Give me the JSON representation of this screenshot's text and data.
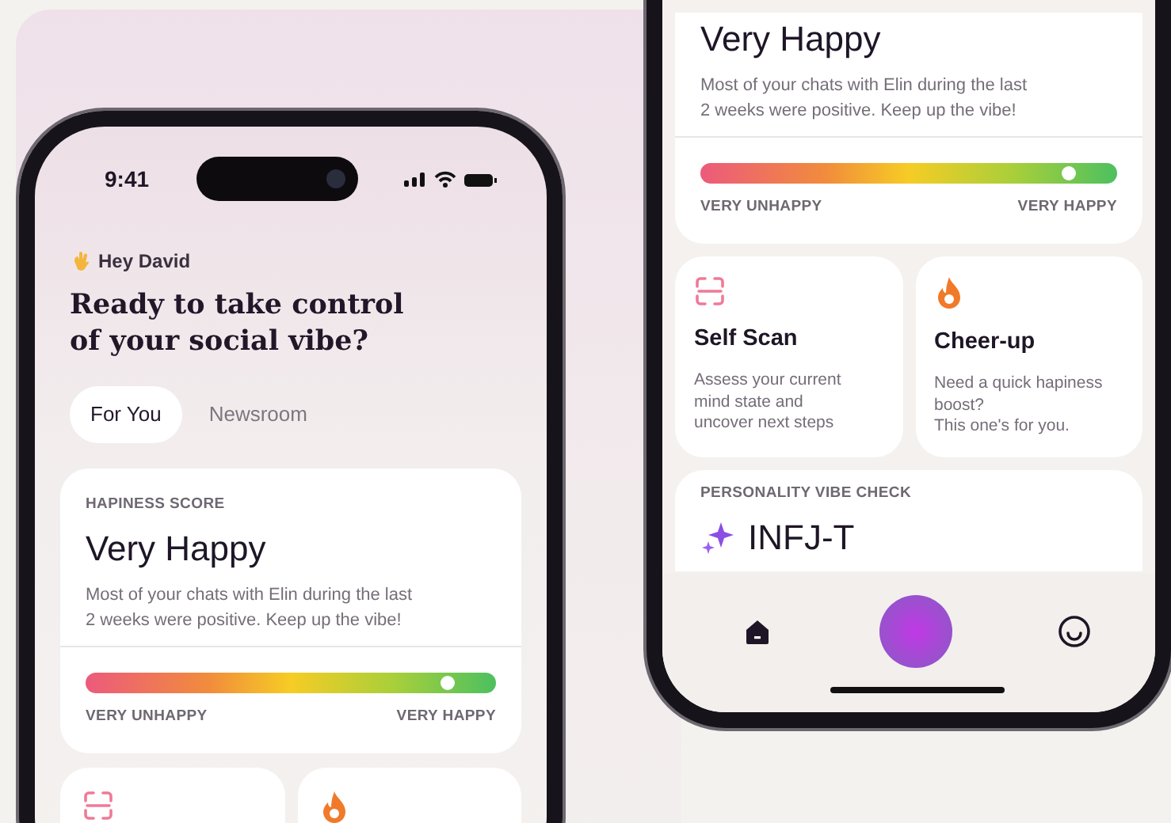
{
  "left_phone": {
    "status_bar": {
      "time": "9:41"
    },
    "greeting": "Hey David",
    "headline": "Ready to take control\nof your social vibe?",
    "tabs": [
      {
        "label": "For You",
        "selected": true
      },
      {
        "label": "Newsroom",
        "selected": false
      }
    ],
    "happiness_card": {
      "label": "HAPINESS SCORE",
      "value": "Very Happy",
      "description": "Most of your chats with Elin during the last\n2 weeks were positive. Keep up the vibe!",
      "level": 0.9,
      "min_label": "VERY UNHAPPY",
      "max_label": "VERY HAPPY"
    },
    "feature_cards": [
      {
        "kind": "scan"
      },
      {
        "kind": "flame"
      }
    ]
  },
  "right_phone": {
    "happiness_card": {
      "value": "Very Happy",
      "description": "Most of your chats with Elin during the last\n2 weeks were positive. Keep up the vibe!",
      "level": 0.9,
      "min_label": "VERY UNHAPPY",
      "max_label": "VERY HAPPY"
    },
    "feature_cards": [
      {
        "kind": "scan",
        "title": "Self Scan",
        "description": "Assess your current\nmind state and\nuncover next steps"
      },
      {
        "kind": "flame",
        "title": "Cheer-up",
        "description": "Need a quick hapiness\nboost?\nThis one's for you."
      }
    ],
    "personality_card": {
      "label": "PERSONALITY VIBE CHECK",
      "value": "INFJ-T"
    },
    "nav": [
      {
        "kind": "home"
      },
      {
        "kind": "orb"
      },
      {
        "kind": "smiley"
      }
    ]
  }
}
